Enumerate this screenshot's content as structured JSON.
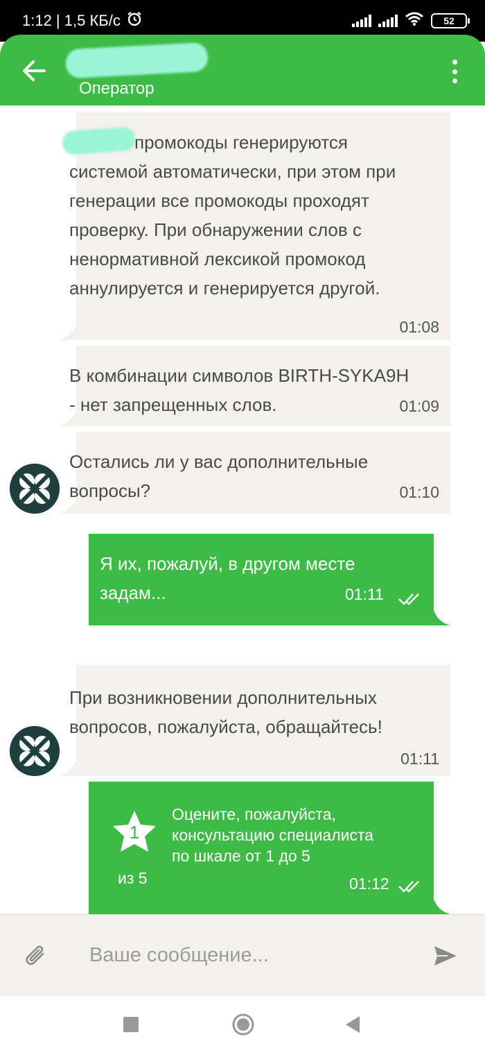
{
  "status_bar": {
    "time_speed": "1:12 | 1,5 КБ/с",
    "battery": "52"
  },
  "header": {
    "subtitle": "Оператор"
  },
  "messages": [
    {
      "direction": "in",
      "lines": [
        "промокоды генерируются",
        "системой автоматически, при этом при",
        "генерации все промокоды проходят",
        "проверку. При обнаружении слов с",
        "ненормативной лексикой промокод",
        "аннулируется и генерируется другой."
      ],
      "time": "01:08"
    },
    {
      "direction": "in",
      "lines": [
        "В комбинации символов BIRTH-SYKA9H",
        "- нет запрещенных слов."
      ],
      "time": "01:09"
    },
    {
      "direction": "in",
      "lines": [
        "Остались ли у вас дополнительные",
        "вопросы?"
      ],
      "time": "01:10"
    },
    {
      "direction": "out",
      "lines": [
        "Я их, пожалуй, в другом месте",
        "задам..."
      ],
      "time": "01:11"
    },
    {
      "direction": "in",
      "lines": [
        "При возникновении дополнительных",
        "вопросов, пожалуйста, обращайтесь!"
      ],
      "time": "01:11"
    },
    {
      "direction": "out",
      "rating": {
        "value": "1",
        "of": "из 5",
        "lines": [
          "Оцените, пожалуйста,",
          "консультацию специалиста",
          "по шкале от 1 до 5"
        ]
      },
      "time": "01:12"
    }
  ],
  "input": {
    "placeholder": "Ваше сообщение..."
  },
  "colors": {
    "brand_green": "#3dbb46",
    "incoming_bubble": "#f2f1ed",
    "avatar": "#1e3f3d"
  }
}
